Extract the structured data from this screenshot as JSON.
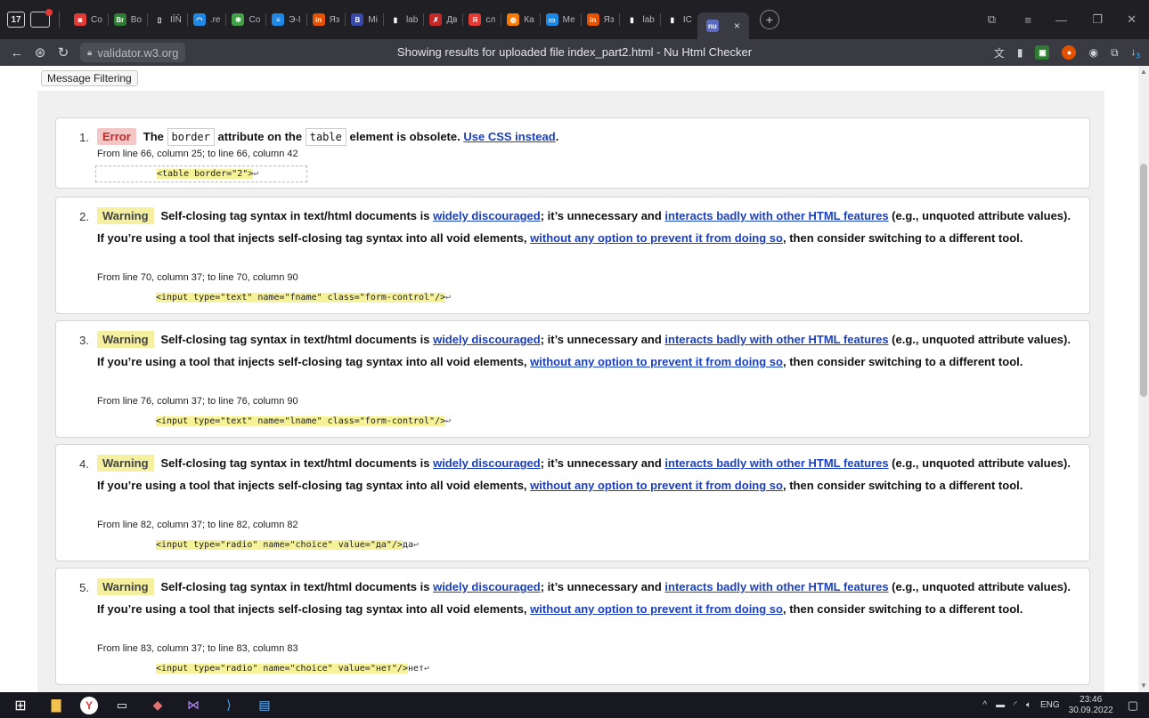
{
  "browser": {
    "tab_count": "17",
    "tabs": [
      {
        "label": "Co",
        "color": "#e53935",
        "glyph": "◙"
      },
      {
        "label": "Bo",
        "color": "#2e7d32",
        "glyph": "Br"
      },
      {
        "label": "IĪŇ",
        "color": "#1f1f24",
        "glyph": "▯"
      },
      {
        "label": ".re",
        "color": "#1e88e5",
        "glyph": "◠"
      },
      {
        "label": "Co",
        "color": "#43a047",
        "glyph": "✱"
      },
      {
        "label": "Э-Ι",
        "color": "#1e88e5",
        "glyph": "≡"
      },
      {
        "label": "Яз",
        "color": "#e65100",
        "glyph": "in"
      },
      {
        "label": "Mi",
        "color": "#3949ab",
        "glyph": "B"
      },
      {
        "label": "lab",
        "color": "#1f1f24",
        "glyph": "▮"
      },
      {
        "label": "Дв",
        "color": "#c62828",
        "glyph": "✗"
      },
      {
        "label": "сл",
        "color": "#e53935",
        "glyph": "Я"
      },
      {
        "label": "Ка",
        "color": "#f57c00",
        "glyph": "◍"
      },
      {
        "label": "Ме",
        "color": "#1e88e5",
        "glyph": "▭"
      },
      {
        "label": "Яз",
        "color": "#e65100",
        "glyph": "in"
      },
      {
        "label": "lab",
        "color": "#1f1f24",
        "glyph": "▮"
      },
      {
        "label": "IC",
        "color": "#1f1f24",
        "glyph": "▮"
      }
    ],
    "active_tab": {
      "label": "nu",
      "close": "×"
    },
    "domain": "validator.w3.org",
    "page_title": "Showing results for uploaded file index_part2.html - Nu Html Checker",
    "download_badge": "3"
  },
  "toolbar": {
    "message_filtering": "Message Filtering"
  },
  "messages": [
    {
      "number": "1.",
      "type": "Error",
      "text_1": "The ",
      "code_1": "border",
      "text_2": " attribute on the ",
      "code_2": "table",
      "text_3": " element is obsolete. ",
      "link_1": "Use CSS instead",
      "text_4": ".",
      "location": "From line 66, column 25; to line 66, column 42",
      "extract": "<table border=\"2\">",
      "extract_tail": ""
    },
    {
      "number": "2.",
      "type": "Warning",
      "text_1": "Self-closing tag syntax in text/html documents is ",
      "link_1": "widely discouraged",
      "text_2": "; it’s unnecessary and ",
      "link_2": "interacts badly with other HTML features",
      "text_3": " (e.g., unquoted attribute values). If you’re using a tool that injects self-closing tag syntax into all void elements, ",
      "link_3": "without any option to prevent it from doing so",
      "text_4": ", then consider switching to a different tool.",
      "location": "From line 70, column 37; to line 70, column 90",
      "extract": "<input type=\"text\" name=\"fname\" class=\"form-control\"/>",
      "extract_tail": ""
    },
    {
      "number": "3.",
      "type": "Warning",
      "text_1": "Self-closing tag syntax in text/html documents is ",
      "link_1": "widely discouraged",
      "text_2": "; it’s unnecessary and ",
      "link_2": "interacts badly with other HTML features",
      "text_3": " (e.g., unquoted attribute values). If you’re using a tool that injects self-closing tag syntax into all void elements, ",
      "link_3": "without any option to prevent it from doing so",
      "text_4": ", then consider switching to a different tool.",
      "location": "From line 76, column 37; to line 76, column 90",
      "extract": "<input type=\"text\" name=\"lname\" class=\"form-control\"/>",
      "extract_tail": ""
    },
    {
      "number": "4.",
      "type": "Warning",
      "text_1": "Self-closing tag syntax in text/html documents is ",
      "link_1": "widely discouraged",
      "text_2": "; it’s unnecessary and ",
      "link_2": "interacts badly with other HTML features",
      "text_3": " (e.g., unquoted attribute values). If you’re using a tool that injects self-closing tag syntax into all void elements, ",
      "link_3": "without any option to prevent it from doing so",
      "text_4": ", then consider switching to a different tool.",
      "location": "From line 82, column 37; to line 82, column 82",
      "extract": "<input type=\"radio\" name=\"choice\" value=\"да\"/>",
      "extract_tail": "да"
    },
    {
      "number": "5.",
      "type": "Warning",
      "text_1": "Self-closing tag syntax in text/html documents is ",
      "link_1": "widely discouraged",
      "text_2": "; it’s unnecessary and ",
      "link_2": "interacts badly with other HTML features",
      "text_3": " (e.g., unquoted attribute values). If you’re using a tool that injects self-closing tag syntax into all void elements, ",
      "link_3": "without any option to prevent it from doing so",
      "text_4": ", then consider switching to a different tool.",
      "location": "From line 83, column 37; to line 83, column 83",
      "extract": "<input type=\"radio\" name=\"choice\" value=\"нет\"/>",
      "extract_tail": "нет"
    }
  ],
  "taskbar": {
    "lang": "ENG",
    "time": "23:46",
    "date": "30.09.2022"
  },
  "colors": {
    "error_bg": "#f4c7c7",
    "warning_bg": "#f4f0a0",
    "link": "#1a3fbf"
  }
}
